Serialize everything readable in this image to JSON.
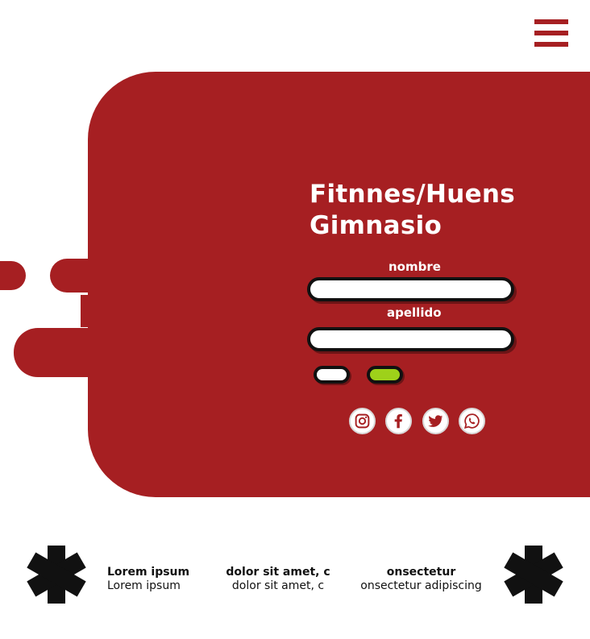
{
  "hero": {
    "title_line1": "Fitnnes/Huens",
    "title_line2": "Gimnasio"
  },
  "form": {
    "first_name_label": "nombre",
    "first_name_value": "",
    "last_name_label": "apellido",
    "last_name_value": ""
  },
  "social_icons": [
    "instagram-icon",
    "facebook-icon",
    "twitter-icon",
    "whatsapp-icon"
  ],
  "footer": {
    "col1_heading": "Lorem ipsum",
    "col1_text": "Lorem ipsum",
    "col2_heading": "dolor sit amet, c",
    "col2_text": "dolor sit amet, c",
    "col3_heading": "onsectetur",
    "col3_text": "onsectetur adipiscing"
  },
  "colors": {
    "primary_red": "#a61f22",
    "submit_green": "#9ed11a",
    "outline_black": "#111111",
    "background": "#ffffff"
  }
}
